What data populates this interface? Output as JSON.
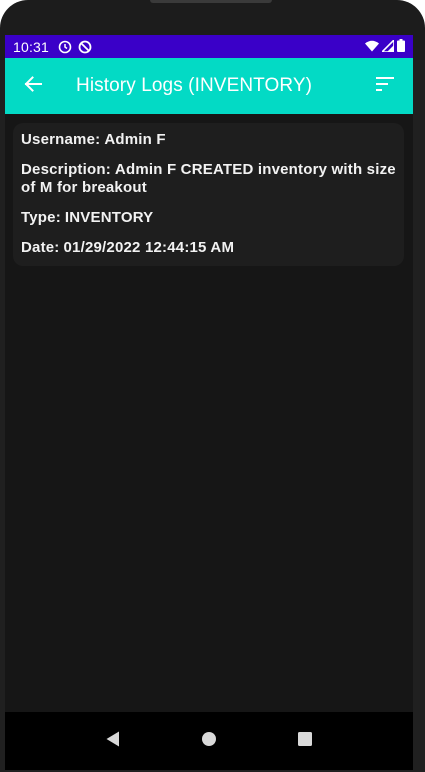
{
  "status_bar": {
    "time": "10:31"
  },
  "app_bar": {
    "title": "History Logs (INVENTORY)"
  },
  "log_entries": [
    {
      "username_label": "Username:",
      "username": "Admin F",
      "description_label": "Description:",
      "description": "Admin F CREATED inventory with size of M for breakout",
      "type_label": "Type:",
      "type": "INVENTORY",
      "date_label": "Date:",
      "date": "01/29/2022 12:44:15 AM"
    }
  ],
  "colors": {
    "status_bar": "#3a00c8",
    "app_bar": "#03dac5",
    "background": "#161616",
    "card": "#1e1e1e",
    "text": "#f2f2f2"
  },
  "icons": {
    "back": "arrow-left-icon",
    "sort": "sort-icon",
    "nav_back": "triangle-back-icon",
    "nav_home": "circle-home-icon",
    "nav_recents": "square-recents-icon"
  }
}
